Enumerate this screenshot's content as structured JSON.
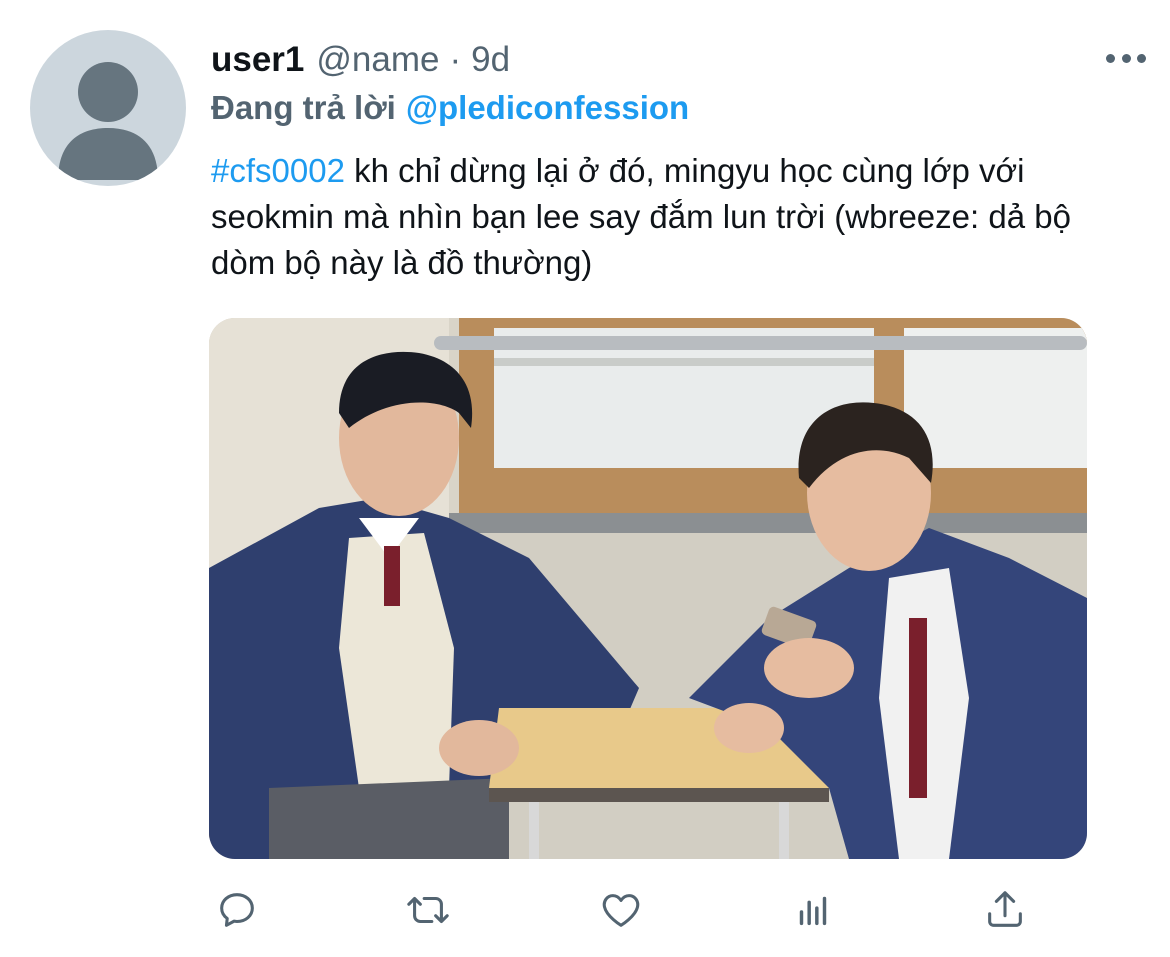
{
  "tweet": {
    "avatar_icon": "default-user-avatar",
    "username": "user1",
    "handle": "@name",
    "separator": "·",
    "time": "9d",
    "more_icon": "more-options-icon",
    "reply": {
      "prefix": "Đang trả lời",
      "mention": "@plediconfession"
    },
    "text": {
      "hashtag": "#cfs0002",
      "body": " kh chỉ dừng lại ở đó, mingyu học cùng lớp với seokmin mà nhìn bạn lee say đắm lun trời (wbreeze: dả bộ dòm bộ này là đồ thường)"
    },
    "media": {
      "type": "photo"
    },
    "actions": [
      {
        "name": "reply",
        "icon": "reply-icon"
      },
      {
        "name": "retweet",
        "icon": "retweet-icon"
      },
      {
        "name": "like",
        "icon": "heart-icon"
      },
      {
        "name": "analytics",
        "icon": "analytics-icon"
      },
      {
        "name": "share",
        "icon": "share-icon"
      }
    ]
  },
  "colors": {
    "accent": "#1d9bf0",
    "secondary_text": "#536471",
    "primary_text": "#0f1419",
    "avatar_bg": "#ccd6dd"
  }
}
